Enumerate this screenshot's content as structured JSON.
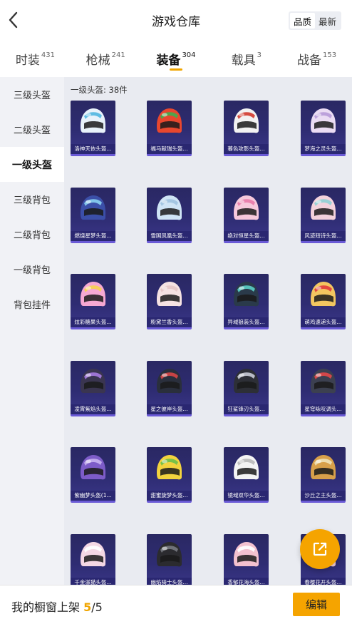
{
  "header": {
    "title": "游戏仓库",
    "sort": [
      "品质",
      "最新"
    ],
    "sort_active": 0
  },
  "tabs": [
    {
      "label": "时装",
      "count": "431"
    },
    {
      "label": "枪械",
      "count": "241"
    },
    {
      "label": "装备",
      "count": "304"
    },
    {
      "label": "载具",
      "count": "3"
    },
    {
      "label": "战备",
      "count": "153"
    }
  ],
  "active_tab": 2,
  "sidebar": {
    "items": [
      "三级头盔",
      "二级头盔",
      "一级头盔",
      "三级背包",
      "二级背包",
      "一级背包",
      "背包挂件"
    ],
    "active": 2
  },
  "content": {
    "section_title": "一级头盔: 38件",
    "items": [
      {
        "name": "洛神天依头盔...",
        "color": "#e8f2fa",
        "accent": "#4fb6e0",
        "icon": "helmet-icon"
      },
      {
        "name": "福马献瑞头盔...",
        "color": "#e8472e",
        "accent": "#3fae4e",
        "icon": "helmet-icon"
      },
      {
        "name": "暮色攻影头盔...",
        "color": "#f2f2f2",
        "accent": "#d23a2e",
        "icon": "helmet-icon"
      },
      {
        "name": "梦海之灵头盔...",
        "color": "#eadcf3",
        "accent": "#b79ad8",
        "icon": "helmet-icon"
      },
      {
        "name": "燃烧星梦头盔...",
        "color": "#3b4fa8",
        "accent": "#8ad0f0",
        "icon": "helmet-icon"
      },
      {
        "name": "雪国凤凰头盔...",
        "color": "#cfe4f5",
        "accent": "#9fc2e0",
        "icon": "helmet-icon"
      },
      {
        "name": "绝对恒星头盔...",
        "color": "#f6c9dc",
        "accent": "#e87aa8",
        "icon": "helmet-icon"
      },
      {
        "name": "风迹短诗头盔...",
        "color": "#f3d2dc",
        "accent": "#8fd0d4",
        "icon": "helmet-icon"
      },
      {
        "name": "炫彩糖果头盔...",
        "color": "#f6a8d2",
        "accent": "#f7d34c",
        "icon": "helmet-icon"
      },
      {
        "name": "粉黛兰香头盔...",
        "color": "#f5e2e2",
        "accent": "#e6c6c6",
        "icon": "helmet-icon"
      },
      {
        "name": "异域狼装头盔...",
        "color": "#2a3a4a",
        "accent": "#5ad0c8",
        "icon": "helmet-icon"
      },
      {
        "name": "萌鸡速递头盔...",
        "color": "#f2c660",
        "accent": "#e03b3b",
        "icon": "helmet-icon"
      },
      {
        "name": "凌霄紫焰头盔...",
        "color": "#3a3550",
        "accent": "#a77be0",
        "icon": "helmet-icon"
      },
      {
        "name": "星之彼岸头盔...",
        "color": "#2a2f3c",
        "accent": "#d84646",
        "icon": "helmet-icon"
      },
      {
        "name": "狂鲨锋刃头盔...",
        "color": "#2d2f36",
        "accent": "#c9ccd6",
        "icon": "helmet-icon"
      },
      {
        "name": "星穹咏叹调头...",
        "color": "#3c4050",
        "accent": "#e34848",
        "icon": "helmet-icon"
      },
      {
        "name": "紫幽梦头盔(1...",
        "color": "#7d5cc8",
        "accent": "#c8b4f0",
        "icon": "helmet-icon"
      },
      {
        "name": "甜蜜旋梦头盔...",
        "color": "#f2d33e",
        "accent": "#6cbf4a",
        "icon": "helmet-icon"
      },
      {
        "name": "镜域双华头盔...",
        "color": "#f4f4f4",
        "accent": "#b9b9b9",
        "icon": "helmet-icon"
      },
      {
        "name": "沙丘之主头盔...",
        "color": "#d8a04a",
        "accent": "#f0e2b8",
        "icon": "helmet-icon"
      },
      {
        "name": "千金滋猫头盔...",
        "color": "#f4d7e4",
        "accent": "#ffffff",
        "icon": "helmet-icon"
      },
      {
        "name": "幽焰骑士头盔...",
        "color": "#2b2b2f",
        "accent": "#777a82",
        "icon": "helmet-icon"
      },
      {
        "name": "香郁花海头盔...",
        "color": "#f3c1cf",
        "accent": "#ffffff",
        "icon": "helmet-icon"
      },
      {
        "name": "春樱花开头盔...",
        "color": "#f6cfd8",
        "accent": "#ffffff",
        "icon": "helmet-icon"
      }
    ]
  },
  "share_icon": "external-link-icon",
  "bottom": {
    "showcase_label": "我的橱窗上架",
    "showcase_count": "5",
    "showcase_total": "/5",
    "edit_label": "编辑"
  },
  "colors": {
    "accent": "#f5a400",
    "card_bg": "#2e2c72"
  }
}
